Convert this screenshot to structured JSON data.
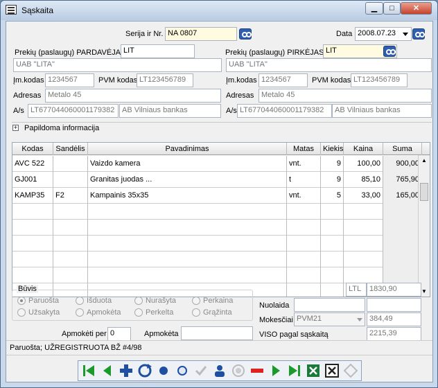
{
  "window": {
    "title": "Sąskaita"
  },
  "header": {
    "serija_label": "Serija ir Nr.",
    "serija_value": "NA 0807",
    "data_label": "Data",
    "data_value": "2008.07.23"
  },
  "seller": {
    "label": "Prekių (paslaugų) PARDAVĖJAS",
    "code": "LIT",
    "name": "UAB \"LITA\"",
    "im_kodas_label": "Įm.kodas",
    "im_kodas": "1234567",
    "pvm_label": "PVM kodas",
    "pvm": "LT123456789",
    "adresas_label": "Adresas",
    "adresas": "Metalo 45",
    "as_label": "A/s",
    "as": "LT677044060001179382",
    "bank": "AB Vilniaus bankas"
  },
  "buyer": {
    "label": "Prekių (paslaugų) PIRKĖJAS",
    "code": "LIT",
    "name": "UAB \"LITA\"",
    "im_kodas_label": "Įm.kodas",
    "im_kodas": "1234567",
    "pvm_label": "PVM kodas",
    "pvm": "LT123456789",
    "adresas_label": "Adresas",
    "adresas": "Metalo 45",
    "as_label": "A/s",
    "as": "LT677044060001179382",
    "bank": "AB Vilniaus bankas"
  },
  "extra_info_label": "Papildoma informacija",
  "table": {
    "columns": [
      "Kodas",
      "Sandėlis",
      "Pavadinimas",
      "Matas",
      "Kiekis",
      "Kaina",
      "Suma"
    ],
    "rows": [
      [
        "AVC 522",
        "",
        "Vaizdo kamera",
        "vnt.",
        "9",
        "100,00",
        "900,00"
      ],
      [
        "GJ001",
        "",
        "Granitas juodas ...",
        "t",
        "9",
        "85,10",
        "765,90"
      ],
      [
        "KAMP35",
        "F2",
        "Kampainis 35x35",
        "vnt.",
        "5",
        "33,00",
        "165,00"
      ]
    ]
  },
  "status_group": {
    "title": "Būvis",
    "options": [
      "Paruošta",
      "Išduota",
      "Nurašyta",
      "Perkaina",
      "Užsakyta",
      "Apmokėta",
      "Perkelta",
      "Grąžinta"
    ],
    "selected": "Paruošta"
  },
  "totals": {
    "currency": "LTL",
    "total": "1830,90",
    "nuolaida_label": "Nuolaida",
    "mokesciai_label": "Mokesčiai",
    "tax_type": "PVM21",
    "tax_value": "384,49",
    "viso_label": "VISO pagal sąskaitą",
    "viso_value": "2215,39"
  },
  "payment": {
    "apmoketi_per_label": "Apmokėti per",
    "apmoketi_per_value": "0",
    "apmoketa_label": "Apmokėta",
    "apmoketa_value": ""
  },
  "status_bar": "Paruošta; UŽREGISTRUOTA BŽ #4/98",
  "colors": {
    "accent": "#2f5fb3",
    "green": "#1a9a2a",
    "red": "#d22"
  }
}
